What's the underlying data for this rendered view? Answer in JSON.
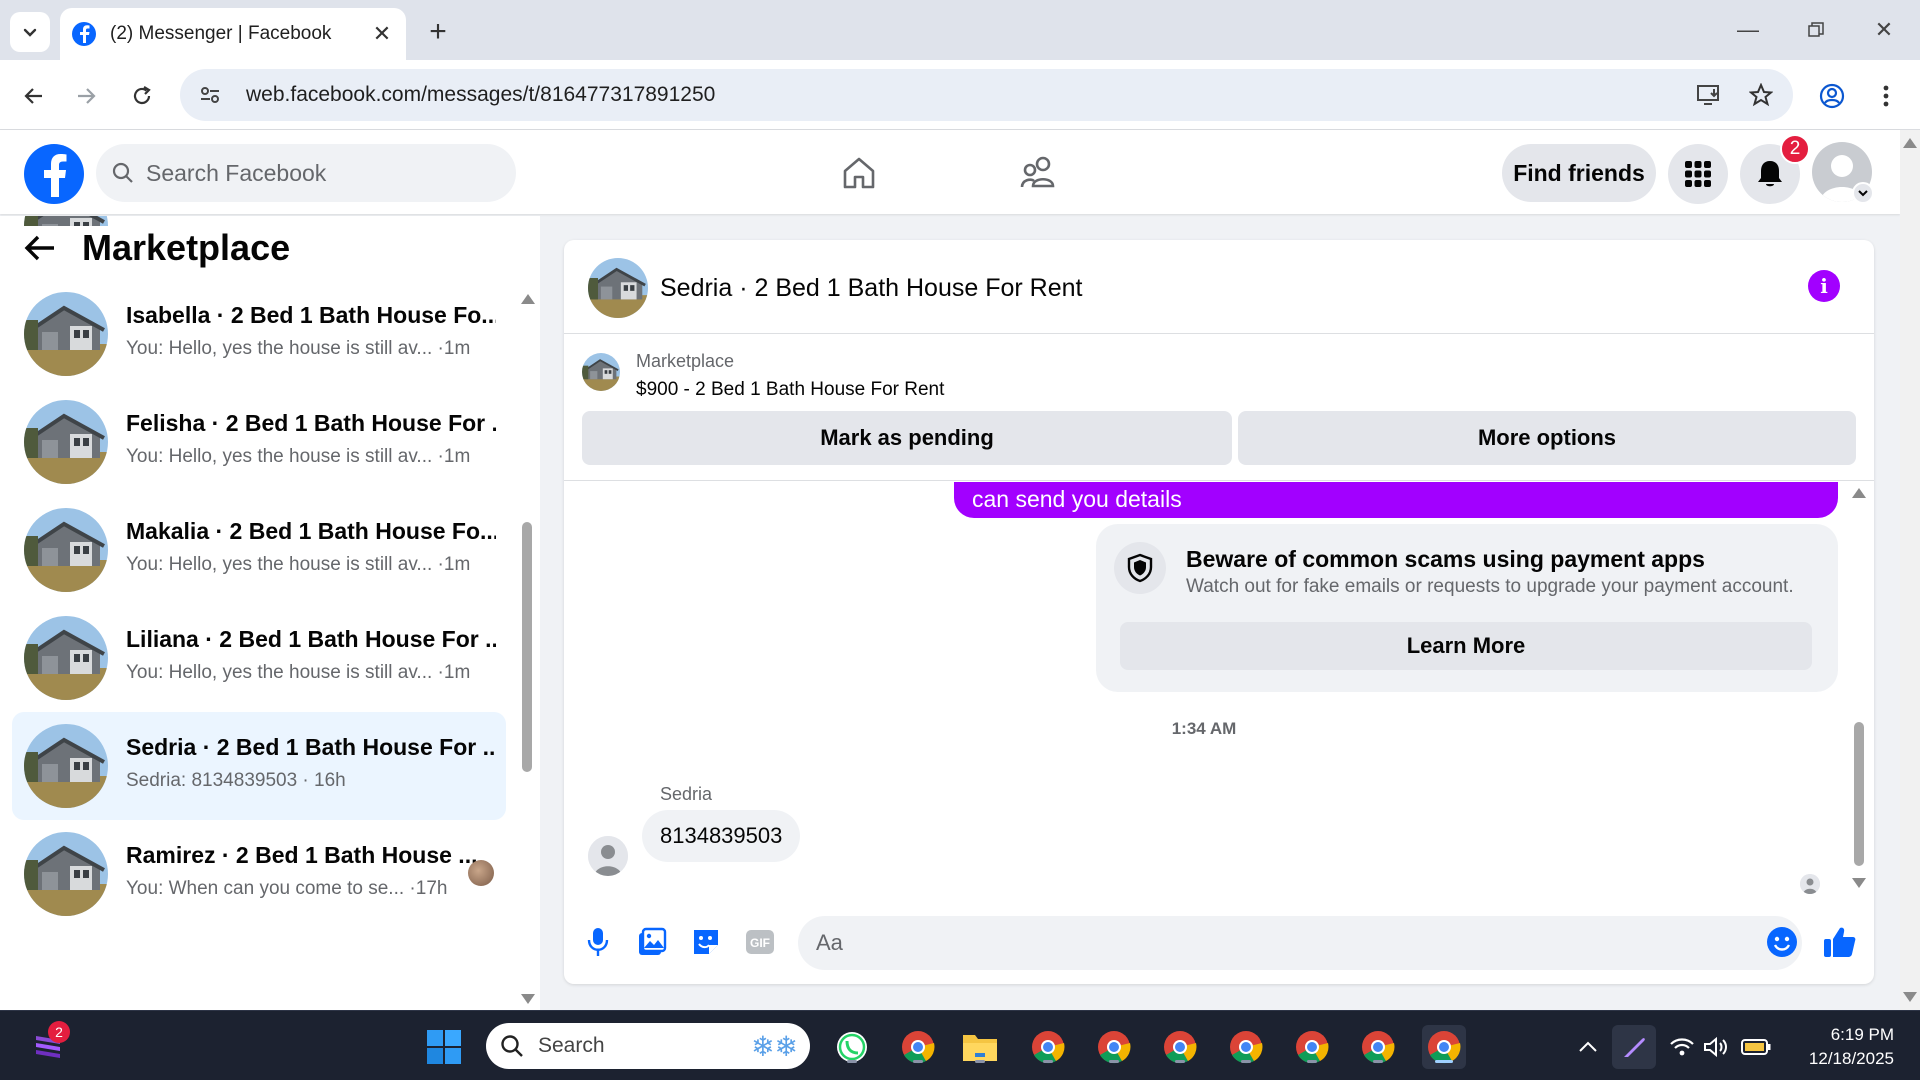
{
  "browser": {
    "tab_title": "(2) Messenger | Facebook",
    "url": "web.facebook.com/messages/t/816477317891250"
  },
  "fb_header": {
    "search_placeholder": "Search Facebook",
    "find_friends_label": "Find friends",
    "notification_count": "2"
  },
  "sidebar": {
    "title": "Marketplace",
    "conversations": [
      {
        "name": "",
        "preview": "You: Hello, yes the house is still av...",
        "time": "1m",
        "active": false
      },
      {
        "name": "Isabella · 2 Bed 1 Bath House Fo...",
        "preview": "You: Hello, yes the house is still av...",
        "time": "1m",
        "active": false
      },
      {
        "name": "Felisha · 2 Bed 1 Bath House For ...",
        "preview": "You: Hello, yes the house is still av...",
        "time": "1m",
        "active": false
      },
      {
        "name": "Makalia · 2 Bed 1 Bath House Fo...",
        "preview": "You: Hello, yes the house is still av...",
        "time": "1m",
        "active": false
      },
      {
        "name": "Liliana · 2 Bed 1 Bath House For ...",
        "preview": "You: Hello, yes the house is still av...",
        "time": "1m",
        "active": false
      },
      {
        "name": "Sedria · 2 Bed 1 Bath House For ...",
        "preview": "Sedria: 8134839503",
        "time": "16h",
        "active": true
      },
      {
        "name": "Ramirez · 2 Bed 1 Bath House ...",
        "preview": "You: When can you come to se...",
        "time": "17h",
        "active": false
      }
    ]
  },
  "chat": {
    "title": "Sedria · 2 Bed 1 Bath House For Rent",
    "listing": {
      "category": "Marketplace",
      "price_title": "$900 - 2 Bed 1 Bath House For Rent",
      "mark_pending_label": "Mark as pending",
      "more_options_label": "More options"
    },
    "sent_message_tail": "can send you  details",
    "scam_card": {
      "title": "Beware of common scams using payment apps",
      "subtitle": "Watch out for fake emails or requests to upgrade your payment account.",
      "button_label": "Learn More"
    },
    "timestamp": "1:34 AM",
    "sender_name": "Sedria",
    "received_message": "8134839503",
    "composer_placeholder": "Aa"
  },
  "taskbar": {
    "search_label": "Search",
    "time": "6:19 PM",
    "date": "12/18/2025",
    "app_badge": "2"
  },
  "colors": {
    "fb_blue": "#0866ff",
    "messenger_purple": "#a200ff",
    "active_conv_bg": "#ebf5ff"
  }
}
